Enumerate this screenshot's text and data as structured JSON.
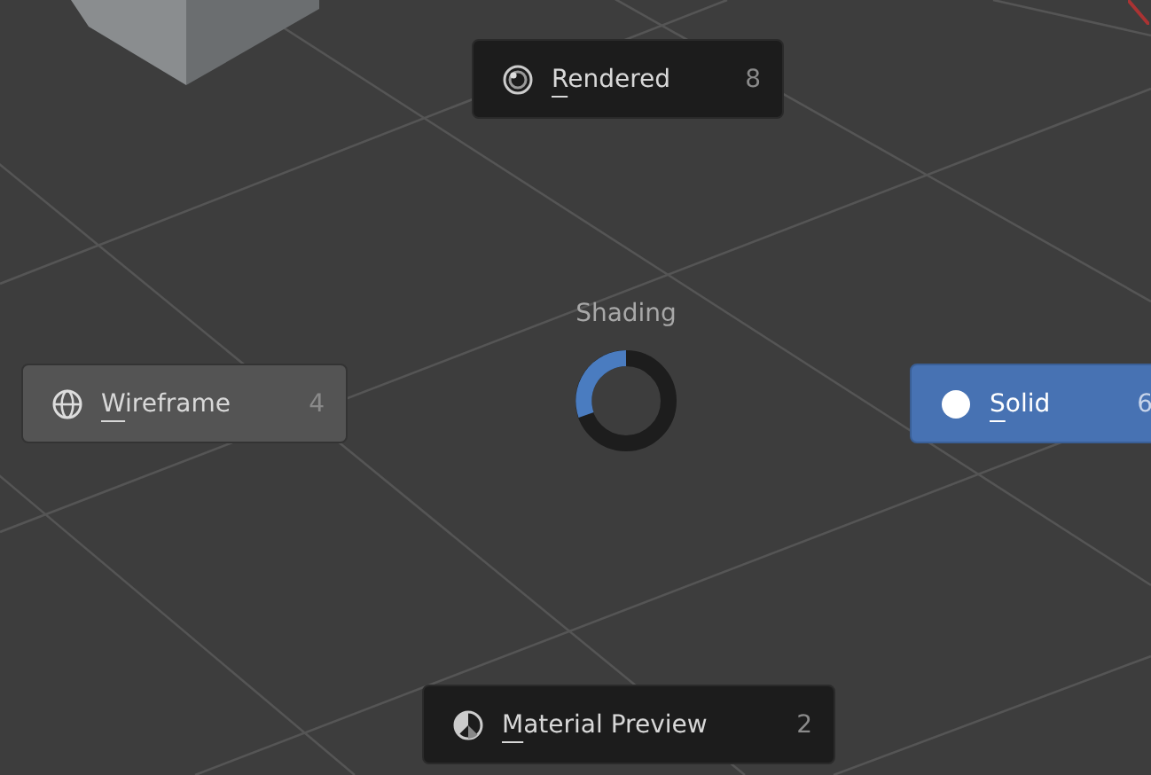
{
  "pie_menu": {
    "title": "Shading",
    "items": [
      {
        "label": "Rendered",
        "shortcut": "8",
        "kind": "rendered",
        "selected": false
      },
      {
        "label": "Wireframe",
        "shortcut": "4",
        "kind": "wireframe",
        "selected": false
      },
      {
        "label": "Solid",
        "shortcut": "6",
        "kind": "solid",
        "selected": true
      },
      {
        "label": "Material Preview",
        "shortcut": "2",
        "kind": "material",
        "selected": false
      }
    ]
  }
}
